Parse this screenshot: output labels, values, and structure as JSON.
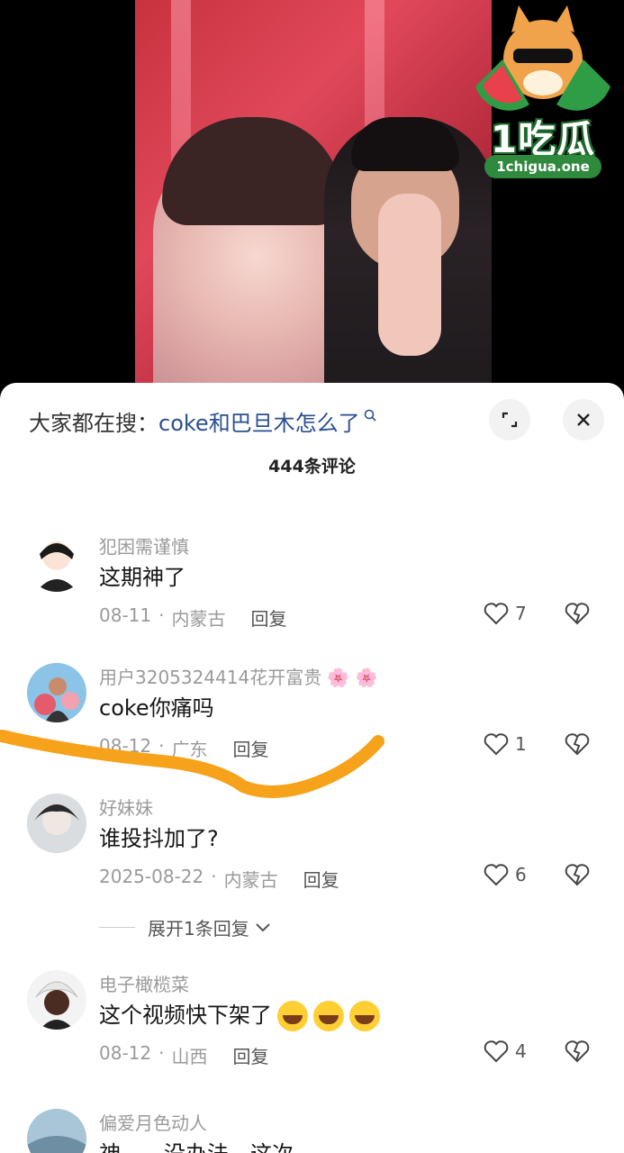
{
  "logo": {
    "brand": "1吃瓜",
    "domain": "1chigua.one"
  },
  "sheet": {
    "search_prefix": "大家都在搜：",
    "search_query": "coke和巴旦木怎么了",
    "comment_count": "444条评论"
  },
  "comments": [
    {
      "username": "犯困需谨慎",
      "text": "这期神了",
      "date": "08-11",
      "location": "内蒙古",
      "reply": "回复",
      "likes": "7"
    },
    {
      "username": "用户3205324414花开富贵",
      "flowers": "🌸 🌸",
      "text": "coke你痛吗",
      "date": "08-12",
      "location": "广东",
      "reply": "回复",
      "likes": "1"
    },
    {
      "username": "好妹妹",
      "text": "谁投抖加了?",
      "date": "2025-08-22",
      "location": "内蒙古",
      "reply": "回复",
      "likes": "6"
    },
    {
      "username": "电子橄榄菜",
      "text": "这个视频快下架了",
      "date": "08-12",
      "location": "山西",
      "reply": "回复",
      "likes": "4"
    },
    {
      "username": "偏爱月色动人",
      "text": "神……没办法，这次"
    }
  ],
  "expand_replies": "展开1条回复",
  "colors": {
    "accent_link": "#2b4f8f",
    "underline": "#f7a21b"
  }
}
